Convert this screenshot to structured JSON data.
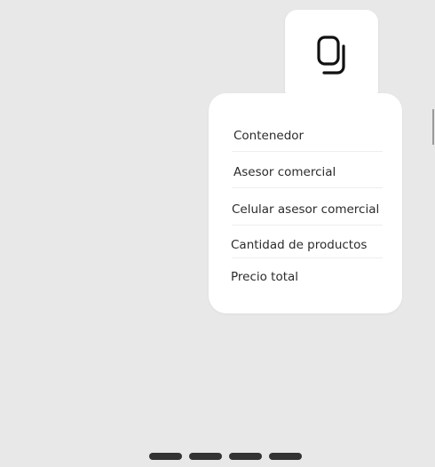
{
  "copy_button": {
    "icon": "copy-icon"
  },
  "menu": {
    "items": [
      {
        "label": "Contenedor"
      },
      {
        "label": "Asesor comercial"
      },
      {
        "label": "Celular asesor comercial"
      },
      {
        "label": "Cantidad de productos"
      },
      {
        "label": "Precio total"
      }
    ]
  },
  "pager": {
    "count": 4
  },
  "colors": {
    "background": "#e8e8e8",
    "card": "#ffffff",
    "text": "#2b2b2b",
    "indicator": "#333333"
  }
}
